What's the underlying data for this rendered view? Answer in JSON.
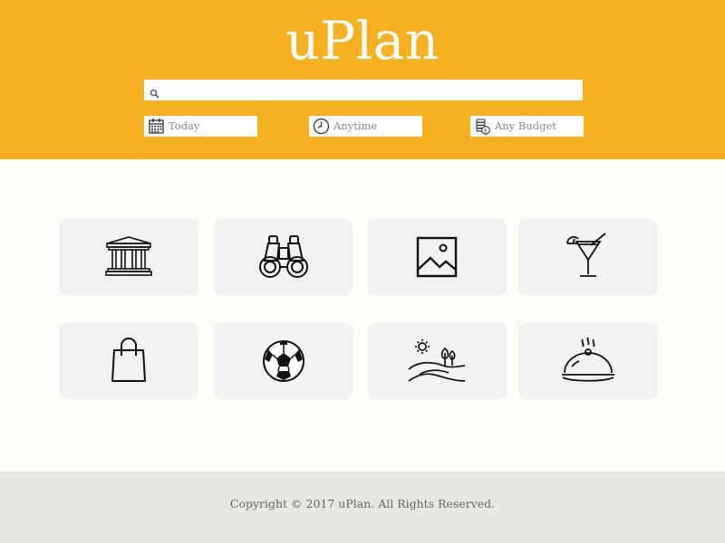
{
  "header": {
    "title": "uPlan",
    "background": "#f5b120",
    "search": {
      "placeholder": "",
      "value": ""
    },
    "filters": {
      "date": {
        "label": "Today",
        "icon": "calendar-icon"
      },
      "time": {
        "label": "Anytime",
        "icon": "clock-icon"
      },
      "budget": {
        "label": "Any Budget",
        "icon": "coins-icon"
      }
    }
  },
  "categories": [
    {
      "icon": "museum-icon"
    },
    {
      "icon": "binoculars-icon"
    },
    {
      "icon": "picture-icon"
    },
    {
      "icon": "cocktail-icon"
    },
    {
      "icon": "shopping-bag-icon"
    },
    {
      "icon": "soccer-ball-icon"
    },
    {
      "icon": "landscape-icon"
    },
    {
      "icon": "food-cloche-icon"
    }
  ],
  "footer": {
    "copyright": "Copyright © 2017 uPlan. All Rights Reserved."
  }
}
